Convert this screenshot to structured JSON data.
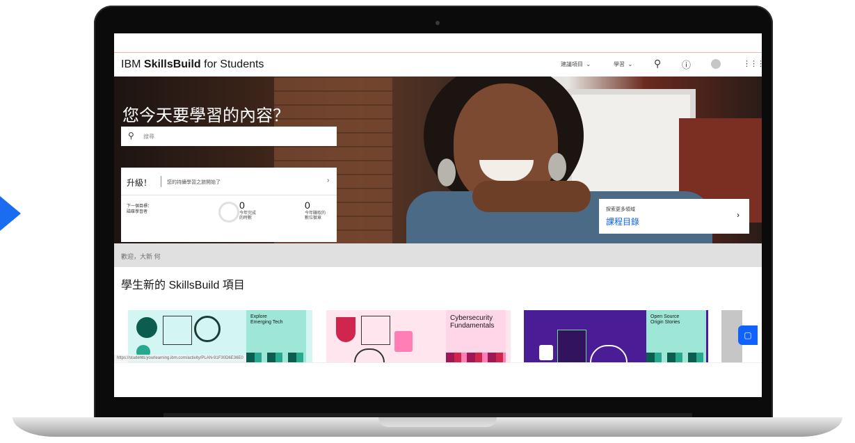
{
  "brand": {
    "prefix": "IBM",
    "bold": "SkillsBuild",
    "suffix": "for Students"
  },
  "nav": {
    "items": [
      {
        "label": "建議項目",
        "icon": "chevron-down-icon"
      },
      {
        "label": "學習",
        "icon": "chevron-down-icon"
      }
    ],
    "icons": [
      "search-icon",
      "help-icon",
      "avatar",
      "app-switcher-icon"
    ]
  },
  "hero": {
    "title": "您今天要學習的內容？",
    "search_placeholder": "搜尋"
  },
  "upgrade_card": {
    "title": "升級！",
    "subtitle": "您的持續學習之旅開始了",
    "goal_label": "下一個目標：\n磁碟學習者",
    "stat1_value": "0",
    "stat1_caption": "今年完成\n的時數",
    "stat2_value": "0",
    "stat2_caption": "今年賺取的\n數位徽章"
  },
  "catalog_card": {
    "small_label": "探索更多領域",
    "link_label": "課程目錄"
  },
  "welcome": {
    "text": "歡迎，大新 何"
  },
  "section": {
    "title": "學生新的 SkillsBuild 項目"
  },
  "tiles": [
    {
      "title": "Explore\nEmerging Tech",
      "color": "#d4f6f3"
    },
    {
      "title": "Cybersecurity\nFundamentals",
      "color": "#ffe6ee"
    },
    {
      "title": "Open Source\nOrigin Stories",
      "color": "#4a1d96"
    }
  ],
  "status_url": "https://students.yourlearning.ibm.com/activity/PLAN-91F30D6E36E0",
  "colors": {
    "accent": "#0f62fe",
    "arrow": "#1a6cf0"
  }
}
